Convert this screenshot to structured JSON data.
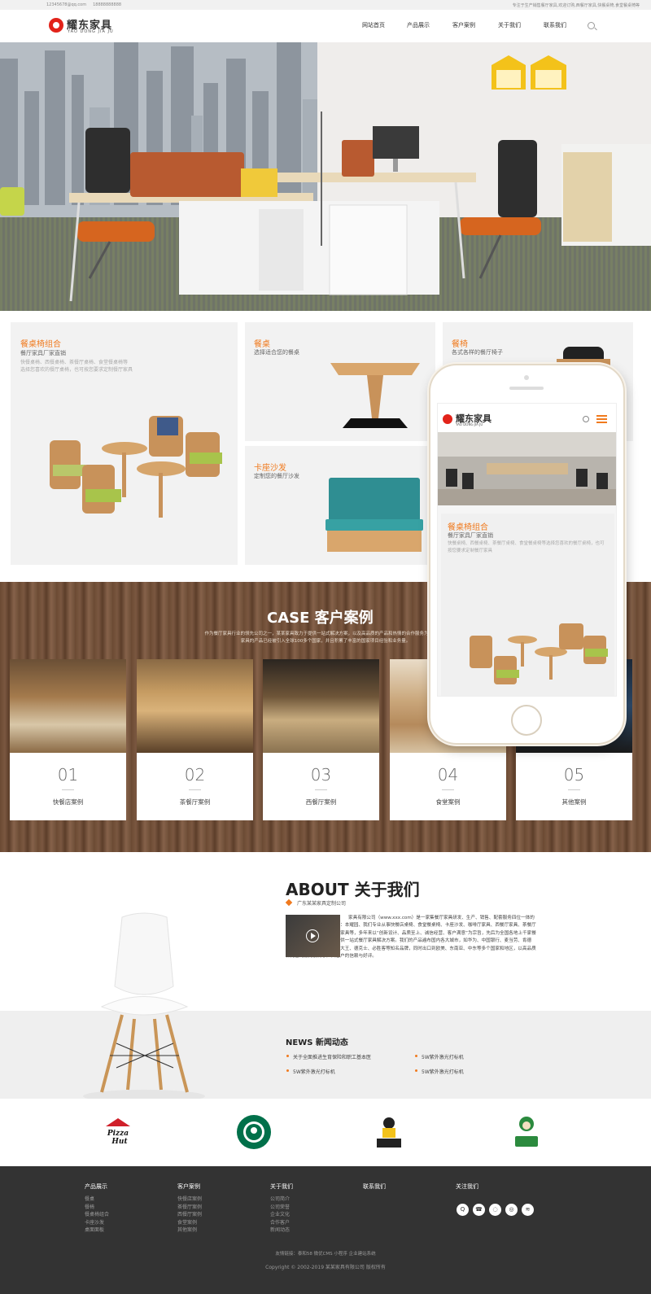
{
  "topbar": {
    "email": "12345678@qq.com",
    "phone": "18888888888",
    "tagline": "专注于生产销售餐厅家具,欢迎订购,西餐厅家具,快餐桌椅,食堂餐桌椅等"
  },
  "brand": {
    "name_cn": "耀东家具",
    "name_en": "YAO DONG JIA JU",
    "accent": "#f07a1e",
    "logo_red": "#e2231a"
  },
  "nav": [
    "网站首页",
    "产品展示",
    "客户案例",
    "关于我们",
    "联系我们"
  ],
  "products": [
    {
      "title": "餐桌椅组合",
      "sub": "餐厅家具厂家直销",
      "desc": [
        "快餐桌椅、西餐桌椅、茶餐厅桌椅、食堂餐桌椅等",
        "选择您喜欢的餐厅桌椅，也可按您要求定制餐厅家具"
      ]
    },
    {
      "title": "餐桌",
      "sub": "选择适合您的餐桌"
    },
    {
      "title": "餐椅",
      "sub": "各式各样的餐厅椅子"
    },
    {
      "title": "卡座沙发",
      "sub": "定制您的餐厅沙发"
    }
  ],
  "case": {
    "title": "CASE 客户案例",
    "desc": "作为餐厅家具行业的领先公司之一，某某家具致力于提供一站式解决方案，以及高品质的产品和热情的合作服务为止，某某家具的产品已经被引入全球100多个国家，并且积累了丰富的国家项目经验和业务量。",
    "items": [
      {
        "num": "01",
        "name": "快餐店案例"
      },
      {
        "num": "02",
        "name": "茶餐厅案例"
      },
      {
        "num": "03",
        "name": "西餐厅案例"
      },
      {
        "num": "04",
        "name": "食堂案例"
      },
      {
        "num": "05",
        "name": "其他案例"
      }
    ]
  },
  "about": {
    "title": "ABOUT 关于我们",
    "company": "广东某某家具定制公司",
    "text": "家具有限公司（www.xxx.com）是一家集餐厅家具研发、生产、销售、配套服务四位一体的家具企业。公司旗下品牌有：本耀园、我们专业从事快餐店桌椅、食堂餐桌椅、卡座沙发、咖啡厅家具、西餐厅家具、茶餐厅桌椅、主题餐厅家具、酒店家具等，多年来以“创新设计、品质至上、诚信经营、客户满意”为宗旨，先后为全国各地上千家餐饮企业及企事业单位食堂提供一站式餐厅家具解决方案。我们的产品遍布国内各大城市，如华为、中国银行、麦当劳、肯德基、真功夫、星巴克、永和大王、德克士、必胜客等知名品牌，同时出口到欧美、东南亚、中东等多个国家和地区，以高品质和完善的服务赢得了广大客户的信赖与好评。",
    "news_title": "NEWS 新闻动态",
    "news": [
      "关于全面推进生育保险和职工基本医",
      "5W紫外激光打标机",
      "5W紫外激光打标机",
      "5W紫外激光打标机"
    ]
  },
  "brands": [
    "Pizza Hut",
    "STARBUCKS COFFEE",
    "真功夫",
    "老乡鸡"
  ],
  "footer": {
    "cols": [
      {
        "title": "产品展示",
        "items": [
          "餐桌",
          "餐椅",
          "餐桌椅组合",
          "卡座沙发",
          "桌面面板"
        ]
      },
      {
        "title": "客户案例",
        "items": [
          "快餐店案例",
          "茶餐厅案例",
          "西餐厅案例",
          "食堂案例",
          "其他案例"
        ]
      },
      {
        "title": "关于我们",
        "items": [
          "公司简介",
          "公司荣誉",
          "企业文化",
          "合作客户",
          "新闻动态"
        ]
      },
      {
        "title": "联系我们",
        "items": []
      },
      {
        "title": "关注我们",
        "items": []
      }
    ],
    "links": "友情链接：泰和58  微优CMS  小程序  企业建站系统",
    "copyright": "Copyright © 2002-2019 某某家具有限公司 版权所有"
  },
  "phone": {
    "card_title": "餐桌椅组合",
    "card_sub": "餐厅家具厂家直销",
    "card_desc": "快餐桌椅、西餐桌椅、茶餐厅桌椅、食堂餐桌椅等选择您喜欢的餐厅桌椅，也可按您要求定制餐厅家具"
  }
}
